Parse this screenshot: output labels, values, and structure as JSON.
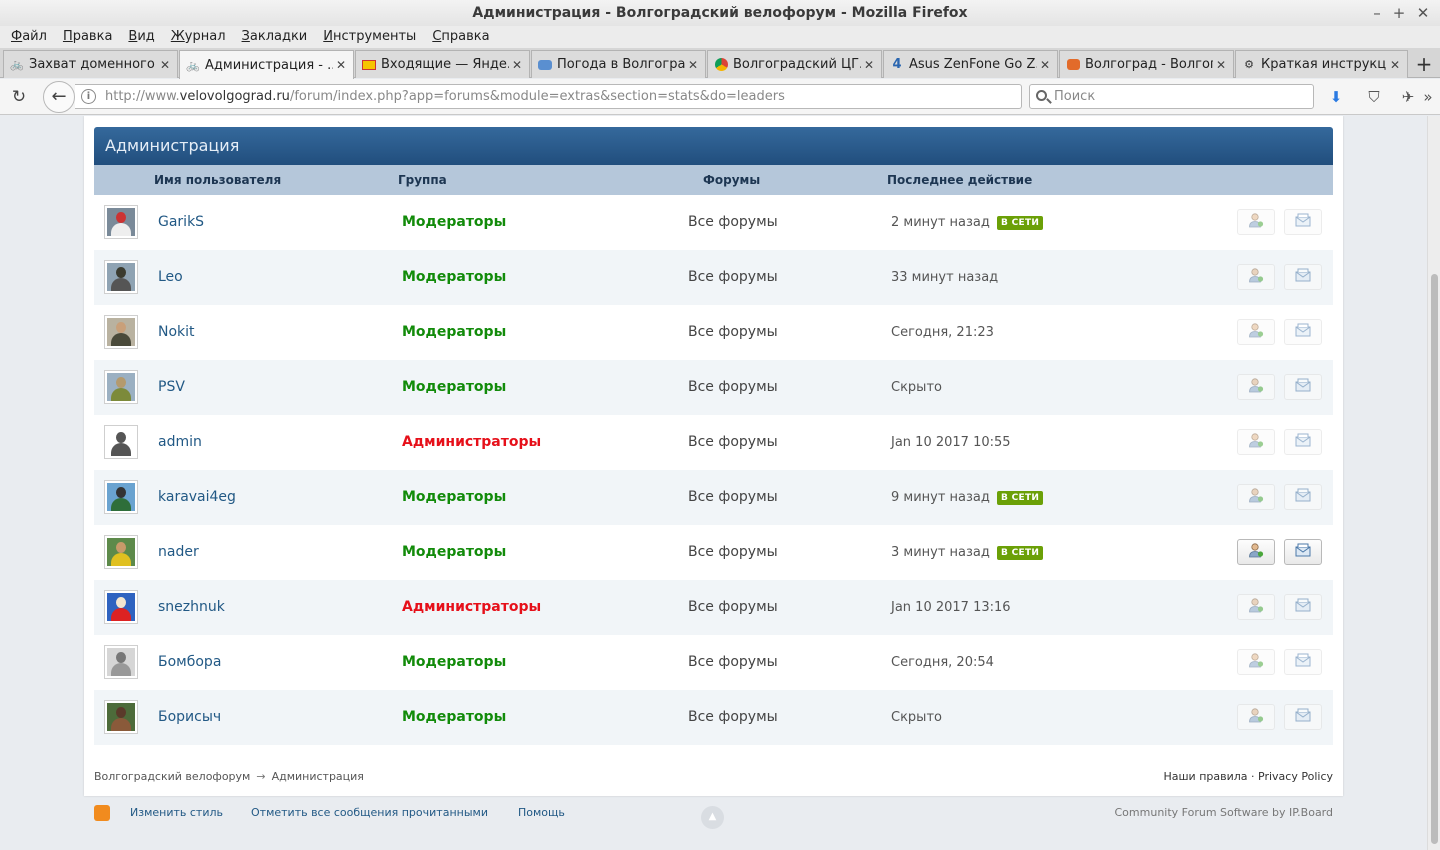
{
  "window": {
    "title": "Администрация - Волгоградский велофорум - Mozilla Firefox",
    "controls": {
      "minimize": "–",
      "maximize": "+",
      "close": "✕"
    }
  },
  "menu": {
    "items": [
      {
        "u": "Ф",
        "rest": "айл"
      },
      {
        "u": "П",
        "rest": "равка"
      },
      {
        "u": "В",
        "rest": "ид"
      },
      {
        "u": "Ж",
        "rest": "урнал"
      },
      {
        "u": "З",
        "rest": "акладки"
      },
      {
        "u": "И",
        "rest": "нструменты"
      },
      {
        "u": "С",
        "rest": "правка"
      }
    ]
  },
  "tabs": [
    {
      "title": "Захват доменного ...",
      "icon": "bike-icon"
    },
    {
      "title": "Администрация - ...",
      "icon": "bike-icon"
    },
    {
      "title": "Входящие — Янде...",
      "icon": "mail-icon"
    },
    {
      "title": "Погода в Волгограде",
      "icon": "weather-icon"
    },
    {
      "title": "Волгоградский ЦГ...",
      "icon": "chrome-icon"
    },
    {
      "title": "Asus ZenFone Go Z...",
      "icon": "4pda-icon"
    },
    {
      "title": "Волгоград - Волгог...",
      "icon": "chat-icon"
    },
    {
      "title": "Краткая инструкц...",
      "icon": "gear-icon"
    }
  ],
  "navbar": {
    "url_prefix": "http://www.",
    "url_host": "velovolgograd.ru",
    "url_rest": "/forum/index.php?app=forums&module=extras&section=stats&do=leaders",
    "search_placeholder": "Поиск"
  },
  "block": {
    "title": "Администрация",
    "columns": {
      "username": "Имя пользователя",
      "group": "Группа",
      "forums": "Форумы",
      "last_action": "Последнее действие"
    }
  },
  "online_label": "В СЕТИ",
  "colors": {
    "moderators": "#128b0a",
    "administrators": "#e6101a",
    "link": "#225985",
    "header": "#2a5b8c",
    "online_badge": "#6ba007"
  },
  "rows": [
    {
      "name": "GarikS",
      "group": "Модераторы",
      "group_type": "mod",
      "forums": "Все форумы",
      "last": "2 минут назад",
      "online": true,
      "enabled": false,
      "av": [
        "#7a8a99",
        "#c33",
        "#eee"
      ]
    },
    {
      "name": "Leo",
      "group": "Модераторы",
      "group_type": "mod",
      "forums": "Все форумы",
      "last": "33 минут назад",
      "online": false,
      "enabled": false,
      "av": [
        "#8fa3b3",
        "#3b3b2f",
        "#555"
      ]
    },
    {
      "name": "Nokit",
      "group": "Модераторы",
      "group_type": "mod",
      "forums": "Все форумы",
      "last": "Сегодня, 21:23",
      "online": false,
      "enabled": false,
      "av": [
        "#b9b2a0",
        "#c9a07a",
        "#4a4a3a"
      ]
    },
    {
      "name": "PSV",
      "group": "Модераторы",
      "group_type": "mod",
      "forums": "Все форумы",
      "last": "Скрыто",
      "online": false,
      "enabled": false,
      "av": [
        "#9bb0c2",
        "#b49a6e",
        "#7c8a3a"
      ]
    },
    {
      "name": "admin",
      "group": "Администраторы",
      "group_type": "adm",
      "forums": "Все форумы",
      "last": "Jan 10 2017 10:55",
      "online": false,
      "enabled": false,
      "av": [
        "#ffffff",
        "#555555",
        "#555555"
      ]
    },
    {
      "name": "karavai4eg",
      "group": "Модераторы",
      "group_type": "mod",
      "forums": "Все форумы",
      "last": "9 минут назад",
      "online": true,
      "enabled": false,
      "av": [
        "#6aa3d0",
        "#333",
        "#2e6e3a"
      ]
    },
    {
      "name": "nader",
      "group": "Модераторы",
      "group_type": "mod",
      "forums": "Все форумы",
      "last": "3 минут назад",
      "online": true,
      "enabled": true,
      "av": [
        "#5d8a4a",
        "#c89a6a",
        "#e0c020"
      ]
    },
    {
      "name": "snezhnuk",
      "group": "Администраторы",
      "group_type": "adm",
      "forums": "Все форумы",
      "last": "Jan 10 2017 13:16",
      "online": false,
      "enabled": false,
      "av": [
        "#2f63c0",
        "#f3e6d0",
        "#d22"
      ]
    },
    {
      "name": "Бомбора",
      "group": "Модераторы",
      "group_type": "mod",
      "forums": "Все форумы",
      "last": "Сегодня, 20:54",
      "online": false,
      "enabled": false,
      "av": [
        "#d6d6d6",
        "#777",
        "#999"
      ]
    },
    {
      "name": "Борисыч",
      "group": "Модераторы",
      "group_type": "mod",
      "forums": "Все форумы",
      "last": "Скрыто",
      "online": false,
      "enabled": false,
      "av": [
        "#4d6b3a",
        "#5a3a2a",
        "#8a5a3a"
      ]
    }
  ],
  "breadcrumb": {
    "home": "Волгоградский велофорум",
    "separator": "→",
    "current": "Администрация"
  },
  "rules": {
    "rules_link": "Наши правила",
    "dot": "·",
    "privacy_link": "Privacy Policy"
  },
  "footer": {
    "change_style": "Изменить стиль",
    "mark_read": "Отметить все сообщения прочитанными",
    "help": "Помощь",
    "powered": "Community Forum Software by IP.Board",
    "to_top": "▲"
  }
}
